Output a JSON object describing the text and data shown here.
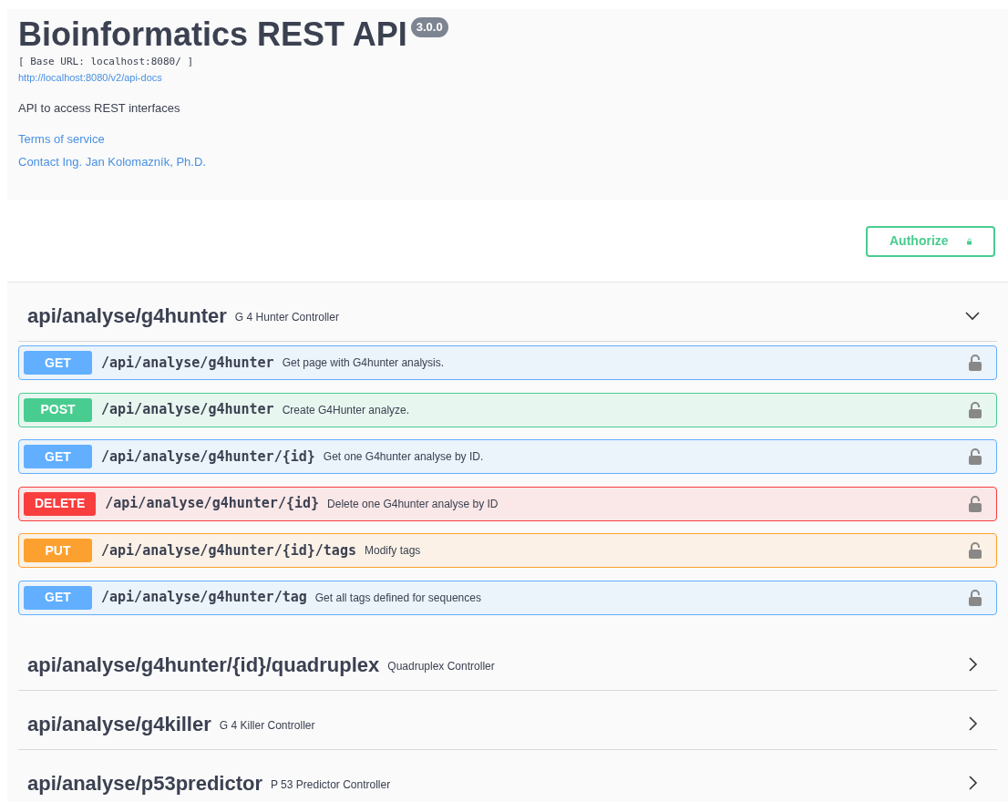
{
  "info": {
    "title": "Bioinformatics REST API",
    "version": "3.0.0",
    "base_url": "[ Base URL: localhost:8080/ ]",
    "spec_link": "http://localhost:8080/v2/api-docs",
    "description": "API to access REST interfaces",
    "terms_link": "Terms of service",
    "contact_link": "Contact Ing. Jan Kolomazník, Ph.D."
  },
  "authorize_button": "Authorize",
  "tags": [
    {
      "name": "api/analyse/g4hunter",
      "description": "G 4 Hunter Controller",
      "expanded": true,
      "operations": [
        {
          "method": "GET",
          "path": "/api/analyse/g4hunter",
          "summary": "Get page with G4hunter analysis."
        },
        {
          "method": "POST",
          "path": "/api/analyse/g4hunter",
          "summary": "Create G4Hunter analyze."
        },
        {
          "method": "GET",
          "path": "/api/analyse/g4hunter/{id}",
          "summary": "Get one G4hunter analyse by ID."
        },
        {
          "method": "DELETE",
          "path": "/api/analyse/g4hunter/{id}",
          "summary": "Delete one G4hunter analyse by ID"
        },
        {
          "method": "PUT",
          "path": "/api/analyse/g4hunter/{id}/tags",
          "summary": "Modify tags"
        },
        {
          "method": "GET",
          "path": "/api/analyse/g4hunter/tag",
          "summary": "Get all tags defined for sequences"
        }
      ]
    },
    {
      "name": "api/analyse/g4hunter/{id}/quadruplex",
      "description": "Quadruplex Controller",
      "expanded": false
    },
    {
      "name": "api/analyse/g4killer",
      "description": "G 4 Killer Controller",
      "expanded": false
    },
    {
      "name": "api/analyse/p53predictor",
      "description": "P 53 Predictor Controller",
      "expanded": false
    }
  ]
}
